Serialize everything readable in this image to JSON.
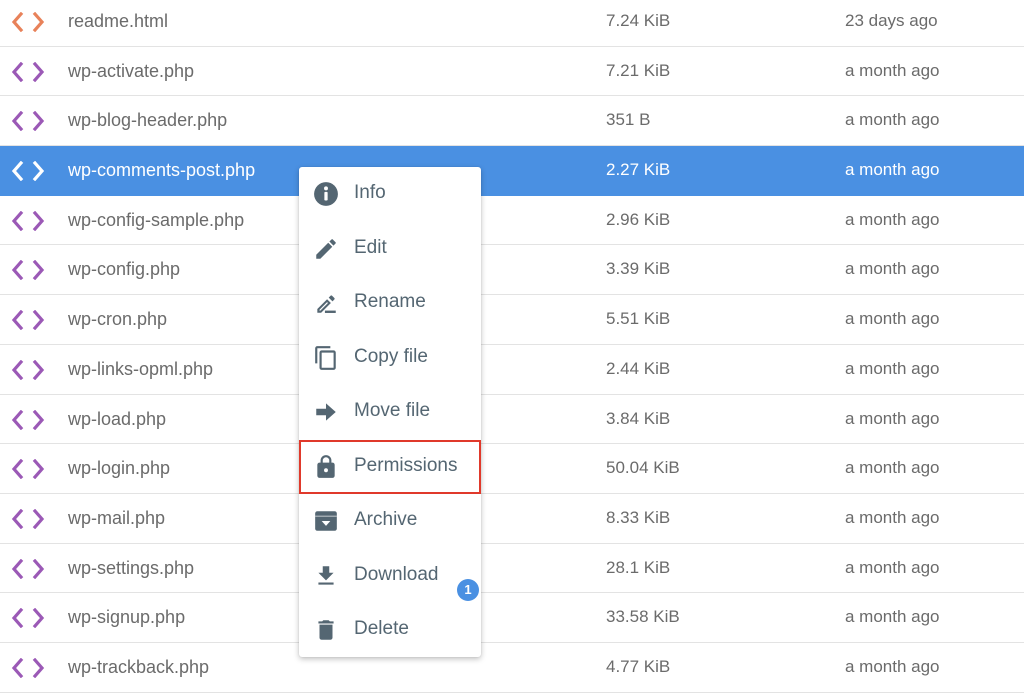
{
  "colors": {
    "selected_row": "#4a90e2",
    "html_icon": "#e8825a",
    "php_icon": "#9b59b6",
    "menu_text": "#546672",
    "highlight_outline": "#e0392b",
    "badge": "#4a90e2"
  },
  "files": [
    {
      "name": "readme.html",
      "size": "7.24 KiB",
      "modified": "23 days ago",
      "icon": "code-icon",
      "type": "html"
    },
    {
      "name": "wp-activate.php",
      "size": "7.21 KiB",
      "modified": "a month ago",
      "icon": "code-icon",
      "type": "php"
    },
    {
      "name": "wp-blog-header.php",
      "size": "351 B",
      "modified": "a month ago",
      "icon": "code-icon",
      "type": "php"
    },
    {
      "name": "wp-comments-post.php",
      "size": "2.27 KiB",
      "modified": "a month ago",
      "icon": "code-icon",
      "type": "php",
      "selected": true
    },
    {
      "name": "wp-config-sample.php",
      "size": "2.96 KiB",
      "modified": "a month ago",
      "icon": "code-icon",
      "type": "php"
    },
    {
      "name": "wp-config.php",
      "size": "3.39 KiB",
      "modified": "a month ago",
      "icon": "code-icon",
      "type": "php"
    },
    {
      "name": "wp-cron.php",
      "size": "5.51 KiB",
      "modified": "a month ago",
      "icon": "code-icon",
      "type": "php"
    },
    {
      "name": "wp-links-opml.php",
      "size": "2.44 KiB",
      "modified": "a month ago",
      "icon": "code-icon",
      "type": "php"
    },
    {
      "name": "wp-load.php",
      "size": "3.84 KiB",
      "modified": "a month ago",
      "icon": "code-icon",
      "type": "php"
    },
    {
      "name": "wp-login.php",
      "size": "50.04 KiB",
      "modified": "a month ago",
      "icon": "code-icon",
      "type": "php"
    },
    {
      "name": "wp-mail.php",
      "size": "8.33 KiB",
      "modified": "a month ago",
      "icon": "code-icon",
      "type": "php"
    },
    {
      "name": "wp-settings.php",
      "size": "28.1 KiB",
      "modified": "a month ago",
      "icon": "code-icon",
      "type": "php"
    },
    {
      "name": "wp-signup.php",
      "size": "33.58 KiB",
      "modified": "a month ago",
      "icon": "code-icon",
      "type": "php"
    },
    {
      "name": "wp-trackback.php",
      "size": "4.77 KiB",
      "modified": "a month ago",
      "icon": "code-icon",
      "type": "php"
    }
  ],
  "context_menu": {
    "items": [
      {
        "label": "Info",
        "icon": "info-icon"
      },
      {
        "label": "Edit",
        "icon": "pencil-icon"
      },
      {
        "label": "Rename",
        "icon": "rename-icon"
      },
      {
        "label": "Copy file",
        "icon": "copy-icon"
      },
      {
        "label": "Move file",
        "icon": "arrow-right-icon"
      },
      {
        "label": "Permissions",
        "icon": "lock-icon",
        "highlighted": true
      },
      {
        "label": "Archive",
        "icon": "archive-icon"
      },
      {
        "label": "Download",
        "icon": "download-icon"
      },
      {
        "label": "Delete",
        "icon": "trash-icon"
      }
    ]
  },
  "badge": {
    "count": "1"
  }
}
